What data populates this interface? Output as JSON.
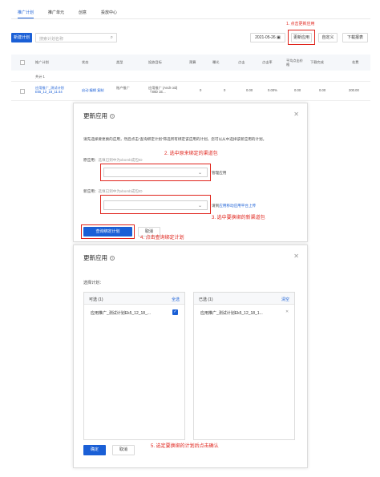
{
  "top": {
    "tabs": [
      "推广计划",
      "推广单元",
      "创意",
      "投放中心"
    ],
    "annotation1": "1. 点击更新应用",
    "create_button": "新建计划",
    "search_placeholder": "搜索计划名称",
    "date": "2021-05-26",
    "update_app_button": "更新应用",
    "custom_button": "自定义",
    "download_button": "下载报表",
    "columns": [
      "推广计划",
      "状态",
      "类型",
      "投放目标",
      "预算",
      "曝光",
      "点击",
      "点击率",
      "平均点击价格",
      "下载完成",
      "花费"
    ],
    "total_row": {
      "label": "共计 1"
    },
    "data_row": {
      "name": "应用推广_测试计划Ek5_12_18_11:44",
      "actions": "启动 编辑 复制",
      "type": "账户推广",
      "target": "应用推广 (Andr oid) 「88D 1E...",
      "budget": "0",
      "impressions": "0",
      "clicks": "0.00",
      "ctr": "0.00%",
      "cpc": "0.00",
      "downloads": "0.00",
      "cost": "200.00"
    }
  },
  "dialog1": {
    "title": "更新应用",
    "description": "请先选择要更换的应用，然后点击“查询绑定计划”筛选所有绑定该应用的计划，您可以从中选择该新应用的计划。",
    "annotation2": "2. 选中原来绑定的渠道包",
    "old_app_label": "原应用：",
    "old_app_hint": "选填已到中为xbomb成包ID",
    "manage_link": "管理应用",
    "new_app_label": "新应用：",
    "new_app_hint": "选填已到中为xbomb成包ID",
    "upload_hint_prefix": "请到",
    "upload_hint_link": "应用移动应用平台上传",
    "annotation3": "3. 选中要换绑的新渠道包",
    "query_button": "查询绑定计划",
    "cancel_button": "取消",
    "annotation4": "4. 点击查询绑定计划"
  },
  "dialog2": {
    "title": "更新应用",
    "select_label": "选择计划：",
    "left_panel_title": "可选 (1)",
    "select_all": "全选",
    "left_item": "应用推广_测试计划Ek5_12_18_...",
    "right_panel_title": "已选 (1)",
    "clear": "清空",
    "right_item": "应用推广_测试计划Ek5_12_18_1...",
    "confirm_button": "确定",
    "cancel_button": "取消",
    "annotation5": "5. 选定要换绑的计划后点击确认"
  },
  "colors": {
    "primary": "#1a5fd6",
    "annotation": "#e0241c"
  }
}
